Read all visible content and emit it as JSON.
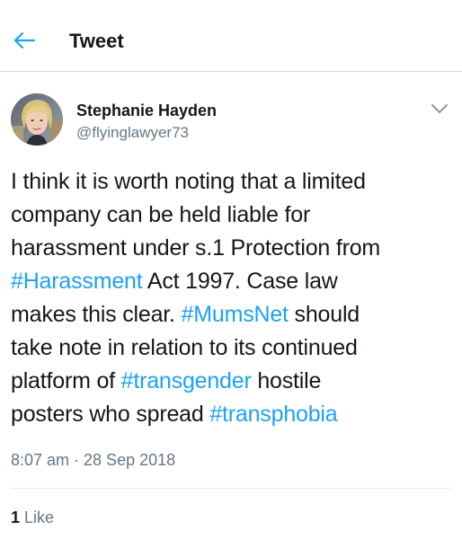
{
  "header": {
    "title": "Tweet",
    "back_icon": "arrow-left-icon",
    "accent_color": "#1da1f2"
  },
  "author": {
    "display_name": "Stephanie Hayden",
    "handle": "@flyinglawyer73",
    "menu_icon": "chevron-down-icon"
  },
  "tweet": {
    "lines": [
      [
        {
          "text": "I think it is worth noting that a limited",
          "hashtag": false
        }
      ],
      [
        {
          "text": "company can be held liable for",
          "hashtag": false
        }
      ],
      [
        {
          "text": "harassment under s.1 Protection from",
          "hashtag": false
        }
      ],
      [
        {
          "text": "#Harassment",
          "hashtag": true
        },
        {
          "text": " Act 1997. Case law",
          "hashtag": false
        }
      ],
      [
        {
          "text": "makes this clear. ",
          "hashtag": false
        },
        {
          "text": "#MumsNet",
          "hashtag": true
        },
        {
          "text": " should",
          "hashtag": false
        }
      ],
      [
        {
          "text": "take note in relation to its continued",
          "hashtag": false
        }
      ],
      [
        {
          "text": "platform of ",
          "hashtag": false
        },
        {
          "text": "#transgender",
          "hashtag": true
        },
        {
          "text": " hostile",
          "hashtag": false
        }
      ],
      [
        {
          "text": "posters who spread ",
          "hashtag": false
        },
        {
          "text": "#transphobia",
          "hashtag": true
        }
      ]
    ],
    "hashtag_color": "#1da1f2"
  },
  "meta": {
    "timestamp": "8:07 am · 28 Sep 2018"
  },
  "stats": {
    "like_count": "1",
    "like_label": " Like"
  }
}
